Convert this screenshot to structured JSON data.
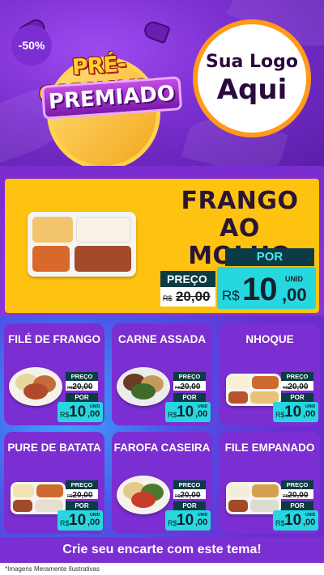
{
  "header": {
    "banner_title": "PRÉ-CARNAVAL",
    "banner_subtitle": "PREMIADO",
    "logo_line1": "Sua Logo",
    "logo_line2": "Aqui"
  },
  "featured": {
    "discount": "-50%",
    "name_line1": "FRANGO",
    "name_line2": "AO MOLHO",
    "old_label": "PREÇO",
    "old_currency": "R$",
    "old_price": "20,00",
    "new_label": "POR",
    "unit": "UNID",
    "currency": "R$",
    "price_int": "10",
    "price_dec": ",00"
  },
  "products": [
    {
      "name": "FILÉ DE FRANGO",
      "old_label": "PREÇO",
      "old_currency": "R$",
      "old_price": "20,00",
      "new_label": "POR",
      "unit": "UNID",
      "currency": "R$",
      "price_int": "10",
      "price_dec": ",00"
    },
    {
      "name": "CARNE ASSADA",
      "old_label": "PREÇO",
      "old_currency": "R$",
      "old_price": "20,00",
      "new_label": "POR",
      "unit": "UNID",
      "currency": "R$",
      "price_int": "10",
      "price_dec": ",00"
    },
    {
      "name": "NHOQUE",
      "old_label": "PREÇO",
      "old_currency": "R$",
      "old_price": "20,00",
      "new_label": "POR",
      "unit": "UNID",
      "currency": "R$",
      "price_int": "10",
      "price_dec": ",00"
    },
    {
      "name": "PURE DE BATATA",
      "old_label": "PREÇO",
      "old_currency": "R$",
      "old_price": "20,00",
      "new_label": "POR",
      "unit": "UNID",
      "currency": "R$",
      "price_int": "10",
      "price_dec": ",00"
    },
    {
      "name": "FAROFA CASEIRA",
      "old_label": "PREÇO",
      "old_currency": "R$",
      "old_price": "20,00",
      "new_label": "POR",
      "unit": "UNID",
      "currency": "R$",
      "price_int": "10",
      "price_dec": ",00"
    },
    {
      "name": "FILE EMPANADO",
      "old_label": "PREÇO",
      "old_currency": "R$",
      "old_price": "20,00",
      "new_label": "POR",
      "unit": "UNID",
      "currency": "R$",
      "price_int": "10",
      "price_dec": ",00"
    }
  ],
  "footer": {
    "cta": "Crie seu encarte com este tema!",
    "disclaimer": "*Imagens Meramente Ilustrativas"
  },
  "colors": {
    "purple": "#7b2ed1",
    "yellow": "#fec211",
    "teal": "#27d7e0",
    "dark_teal": "#0b3b44",
    "orange_ring": "#ff9a1a"
  }
}
